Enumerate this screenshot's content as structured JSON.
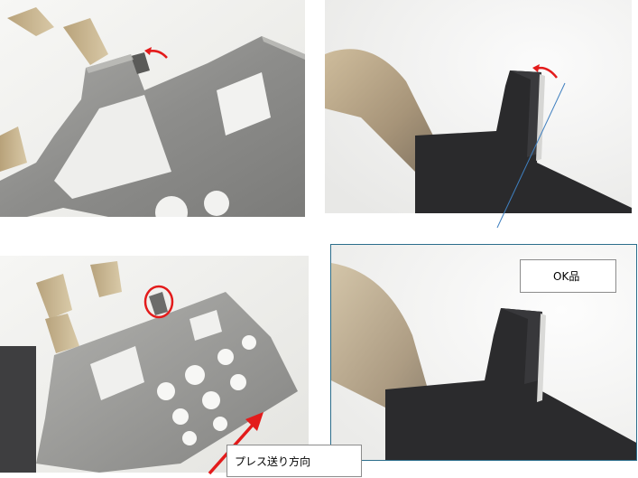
{
  "labels": {
    "ok": "OK品",
    "feed_direction": "プレス送り方向"
  },
  "colors": {
    "annotation": "#e31b1b",
    "frame": "#2c6e8c",
    "guide_line": "#3f7fbf",
    "metal": "#9a9a98",
    "dark_metal": "#2a2a2c",
    "background": "#f4f4f2"
  },
  "icons": {
    "bend_arrow": "curved-arrow-icon",
    "defect_marker": "circle-marker-icon",
    "feed_arrow": "arrow-up-right-icon"
  }
}
